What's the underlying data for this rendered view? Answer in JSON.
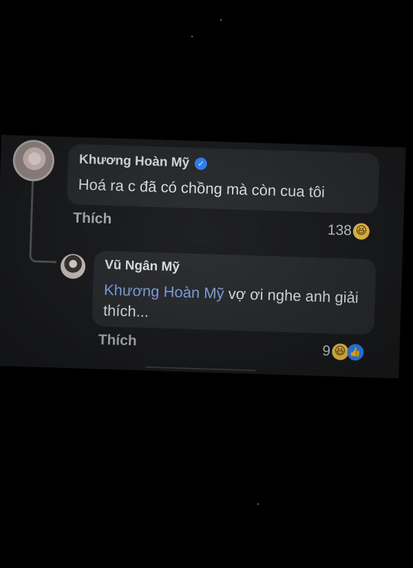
{
  "comment": {
    "author": "Khương Hoàn Mỹ",
    "text": "Hoá ra c đã có chồng mà còn cua tôi",
    "like_label": "Thích",
    "reaction_count": "138",
    "verified_icon": "verified-badge-icon",
    "reaction_icons": [
      "haha-reaction-icon"
    ]
  },
  "reply": {
    "author": "Vũ Ngân Mỹ",
    "mention": "Khương Hoàn Mỹ",
    "text": " vợ ơi nghe anh giải thích...",
    "like_label": "Thích",
    "reaction_count": "9",
    "reaction_icons": [
      "haha-reaction-icon",
      "like-reaction-icon"
    ]
  },
  "colors": {
    "background": "#000000",
    "panel": "#18191b",
    "bubble": "#27292c",
    "text": "#e4e6ea",
    "secondary_text": "#b0b3b8",
    "mention": "#7fa8e6",
    "verified": "#2d88ff",
    "haha": "#f7c948"
  }
}
